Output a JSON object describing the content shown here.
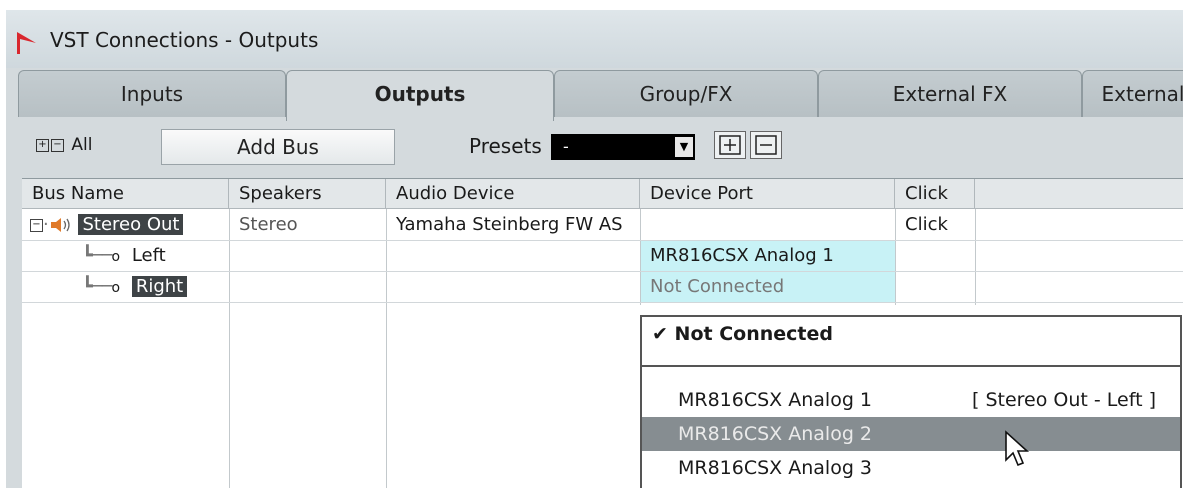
{
  "window": {
    "title": "VST Connections - Outputs"
  },
  "tabs": [
    {
      "label": "Inputs",
      "active": false
    },
    {
      "label": "Outputs",
      "active": true
    },
    {
      "label": "Group/FX",
      "active": false
    },
    {
      "label": "External FX",
      "active": false
    },
    {
      "label": "External",
      "active": false
    }
  ],
  "toolbar": {
    "all_label": "All",
    "add_bus_label": "Add Bus",
    "presets_label": "Presets",
    "presets_value": "-"
  },
  "table": {
    "headers": [
      "Bus Name",
      "Speakers",
      "Audio Device",
      "Device Port",
      "Click"
    ],
    "rows": [
      {
        "bus_name": "Stereo Out",
        "speakers": "Stereo",
        "audio_device": "Yamaha Steinberg FW AS",
        "device_port": "",
        "click": "Click"
      },
      {
        "bus_name": "Left",
        "speakers": "",
        "audio_device": "",
        "device_port": "MR816CSX Analog 1",
        "click": ""
      },
      {
        "bus_name": "Right",
        "speakers": "",
        "audio_device": "",
        "device_port": "Not Connected",
        "click": ""
      }
    ]
  },
  "port_menu": {
    "items": [
      {
        "label": "Not Connected",
        "checked": true,
        "note": ""
      },
      {
        "label": "MR816CSX Analog 1",
        "checked": false,
        "note": "[ Stereo Out - Left ]"
      },
      {
        "label": "MR816CSX Analog 2",
        "checked": false,
        "note": "",
        "hovered": true
      },
      {
        "label": "MR816CSX Analog 3",
        "checked": false,
        "note": ""
      }
    ]
  },
  "colors": {
    "accent_logo": "#d9272e",
    "menu_hover": "#868d91",
    "port_cell": "#c8f2f6"
  }
}
